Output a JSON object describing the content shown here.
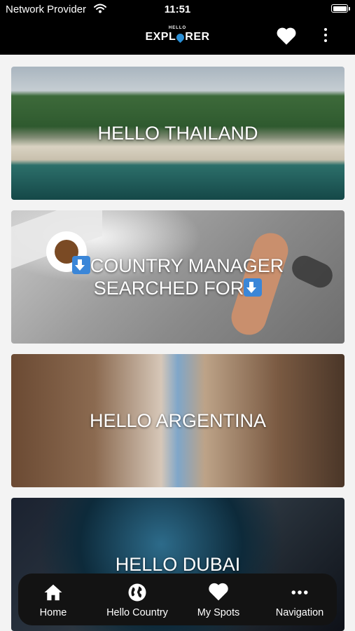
{
  "status_bar": {
    "carrier": "Network Provider",
    "time": "11:51"
  },
  "header": {
    "logo_small": "HELLO",
    "logo_left": "EXPL",
    "logo_right": "RER",
    "logo_full": "HELLO EXPLORER"
  },
  "cards": [
    {
      "title": "HELLO THAILAND"
    },
    {
      "title_line1": "COUNTRY MANAGER",
      "title_line2": "SEARCHED FOR"
    },
    {
      "title": "HELLO ARGENTINA"
    },
    {
      "title": "HELLO DUBAI"
    }
  ],
  "tabs": [
    {
      "label": "Home",
      "icon": "home-icon"
    },
    {
      "label": "Hello Country",
      "icon": "globe-icon"
    },
    {
      "label": "My Spots",
      "icon": "heart-icon"
    },
    {
      "label": "Navigation",
      "icon": "more-horizontal-icon"
    }
  ],
  "colors": {
    "nav_background": "#000000",
    "tab_bar": "#131313",
    "accent_blue": "#3a86d8",
    "text": "#ffffff"
  }
}
